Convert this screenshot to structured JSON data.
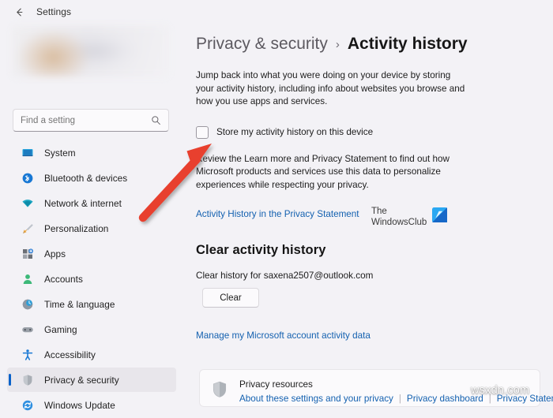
{
  "window": {
    "title": "Settings",
    "back_icon": "back-arrow-icon"
  },
  "sidebar": {
    "search": {
      "placeholder": "Find a setting",
      "value": "",
      "icon": "search-icon"
    },
    "items": [
      {
        "label": "System",
        "icon": "monitor-icon",
        "selected": false
      },
      {
        "label": "Bluetooth & devices",
        "icon": "bluetooth-icon",
        "selected": false
      },
      {
        "label": "Network & internet",
        "icon": "wifi-icon",
        "selected": false
      },
      {
        "label": "Personalization",
        "icon": "paintbrush-icon",
        "selected": false
      },
      {
        "label": "Apps",
        "icon": "apps-grid-icon",
        "selected": false
      },
      {
        "label": "Accounts",
        "icon": "person-icon",
        "selected": false
      },
      {
        "label": "Time & language",
        "icon": "clock-globe-icon",
        "selected": false
      },
      {
        "label": "Gaming",
        "icon": "gamepad-icon",
        "selected": false
      },
      {
        "label": "Accessibility",
        "icon": "accessibility-icon",
        "selected": false
      },
      {
        "label": "Privacy & security",
        "icon": "shield-icon",
        "selected": true
      },
      {
        "label": "Windows Update",
        "icon": "update-refresh-icon",
        "selected": false
      }
    ]
  },
  "main": {
    "breadcrumb": {
      "parent": "Privacy & security",
      "separator": "›",
      "current": "Activity history"
    },
    "intro_text": "Jump back into what you were doing on your device by storing your activity history, including info about websites you browse and how you use apps and services.",
    "store_checkbox": {
      "label": "Store my activity history on this device",
      "checked": false
    },
    "review_text": "Review the Learn more and Privacy Statement to find out how Microsoft products and services use this data to personalize experiences while respecting your privacy.",
    "privacy_statement_link": "Activity History in the Privacy Statement",
    "clear_section": {
      "heading": "Clear activity history",
      "description": "Clear history for saxena2507@outlook.com",
      "button_label": "Clear"
    },
    "manage_link": "Manage my Microsoft account activity data",
    "resource_card": {
      "icon": "shield-icon",
      "title": "Privacy resources",
      "links": [
        "About these settings and your privacy",
        "Privacy dashboard",
        "Privacy Statement"
      ],
      "separator": "|"
    }
  },
  "watermarks": {
    "club_line1": "The",
    "club_line2": "WindowsClub",
    "club_logo": "windowsclub-logo-icon",
    "bottom": "wsxdn.com"
  },
  "annotation": {
    "arrow_color": "#e8412f",
    "arrow_target": "store-activity-history-checkbox"
  },
  "colors": {
    "background": "#f3f2f6",
    "accent": "#0a62c9",
    "link": "#1461b0",
    "selected_row": "#e8e6eb"
  }
}
